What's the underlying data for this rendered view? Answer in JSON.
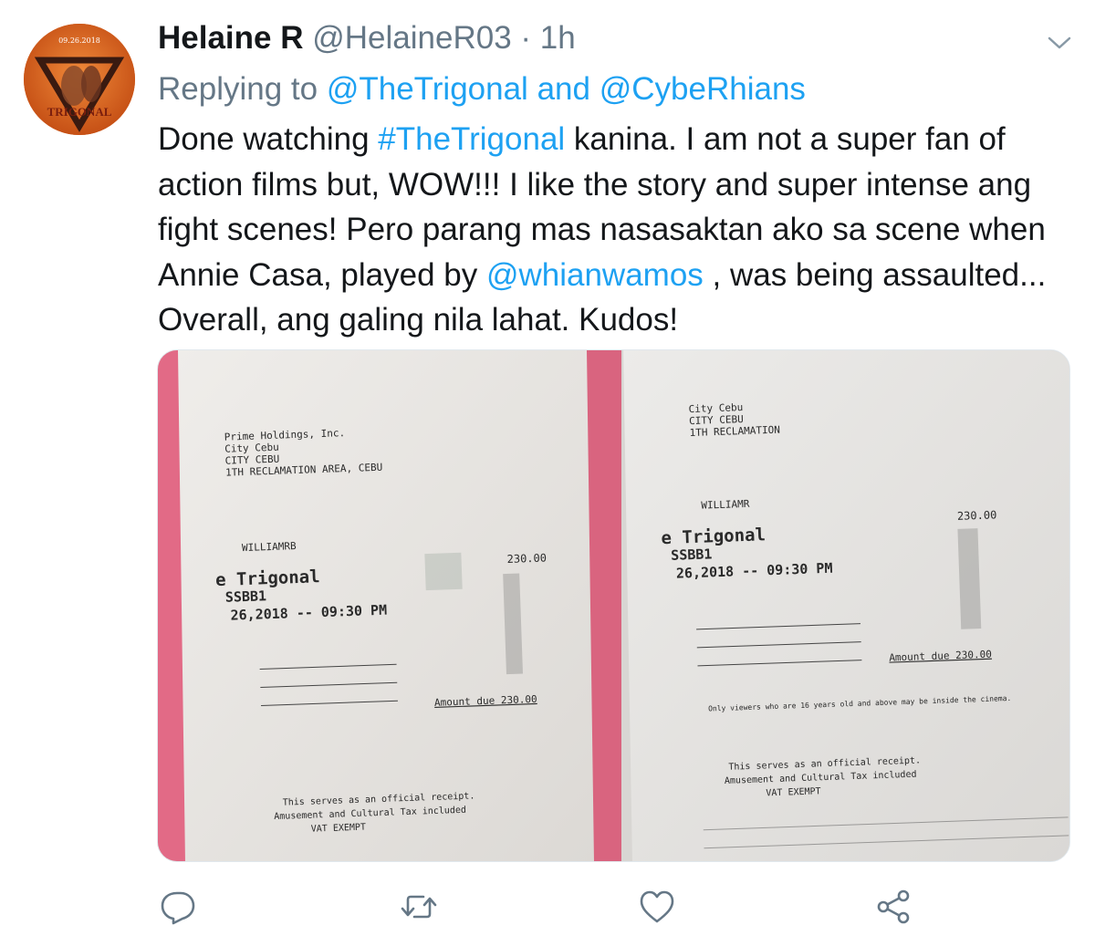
{
  "tweet": {
    "author_name": "Helaine R",
    "author_handle": "@HelaineR03",
    "separator": "·",
    "time": "1h",
    "replying_prefix": "Replying to",
    "reply_target_1": "@TheTrigonal",
    "reply_joiner": "and",
    "reply_target_2": "@CybeRhians",
    "text_1": "Done watching ",
    "hashtag": "#TheTrigonal",
    "text_2": " kanina. I am not a super fan of action films but, WOW!!! I like the story and super intense ang fight scenes! Pero parang mas nasasaktan ako sa scene when Annie Casa, played by ",
    "mention": "@whianwamos",
    "text_3": " , was being assaulted... Overall, ang galing nila lahat. Kudos!"
  },
  "avatar": {
    "date_text": "09.26.2018",
    "logo_text": "TRIGONAL"
  },
  "receipt_left": {
    "lines": [
      "Prime Holdings, Inc.",
      "City Cebu",
      "CITY CEBU",
      "1TH RECLAMATION AREA, CEBU",
      "WILLIAMRB",
      "e Trigonal",
      "SSBB1",
      "26,2018 -- 09:30 PM",
      "Amount due  230.00",
      "This serves as an official receipt.",
      "Amusement and Cultural Tax included",
      "VAT EXEMPT"
    ],
    "price": "230.00"
  },
  "receipt_right": {
    "lines": [
      "City Cebu",
      "CITY CEBU",
      "1TH RECLAMATION",
      "WILLIAMR",
      "e Trigonal",
      "SSBB1",
      "26,2018 -- 09:30 PM",
      "Amount due  230.00",
      "Only viewers who are 16 years old and above may be inside the cinema.",
      "This serves as an official receipt.",
      "Amusement and Cultural Tax included",
      "VAT EXEMPT"
    ],
    "price": "230.00"
  },
  "icons": [
    "chevron-down-icon",
    "reply-icon",
    "retweet-icon",
    "like-icon",
    "share-icon"
  ],
  "colors": {
    "link": "#1da1f2",
    "secondary": "#657786",
    "text": "#14171a",
    "icon": "#657786"
  }
}
